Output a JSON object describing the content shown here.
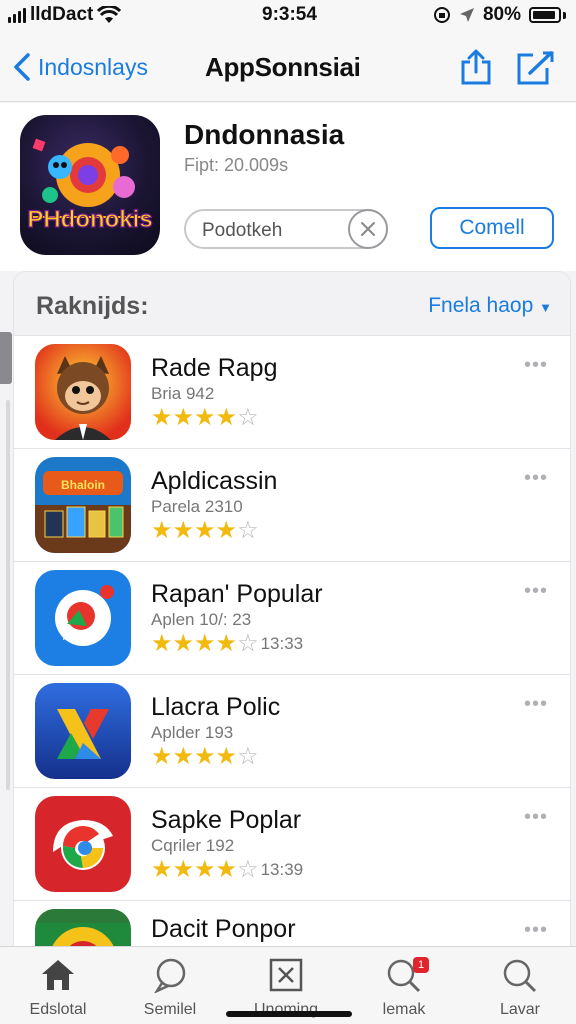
{
  "status_bar": {
    "carrier": "lldDact",
    "time": "9:3:54",
    "battery": "80%"
  },
  "nav": {
    "back_label": "Indosnlays",
    "title": "AppSonnsiai"
  },
  "app": {
    "name": "Dndonnasia",
    "subtitle": "Fipt: 20.009s",
    "icon_text": "PHdonokis",
    "search_value": "Podotkeh",
    "get_label": "Comell"
  },
  "rankings": {
    "title": "Raknijds:",
    "filter_label": "Fnela haop",
    "items": [
      {
        "name": "Rade Rapg",
        "sub": "Bria 942",
        "stars": 4,
        "count": ""
      },
      {
        "name": "Apldicassin",
        "sub": "Parela 2310",
        "stars": 4,
        "count": ""
      },
      {
        "name": "Rapan' Popular",
        "sub": "Aplen 10/: 23",
        "stars": 4,
        "count": "13:33"
      },
      {
        "name": "Llacra Polic",
        "sub": "Aplder 193",
        "stars": 4,
        "count": ""
      },
      {
        "name": "Sapke Poplar",
        "sub": "Cqriler 192",
        "stars": 4,
        "count": "13:39"
      },
      {
        "name": "Dacit Ponpor",
        "sub": "",
        "stars": 0,
        "count": ""
      }
    ]
  },
  "tabs": [
    {
      "label": "Edslotal",
      "icon": "house-icon"
    },
    {
      "label": "Semilel",
      "icon": "speech-bubble-icon"
    },
    {
      "label": "Unoming",
      "icon": "close-box-icon"
    },
    {
      "label": "lemak",
      "icon": "search-badge-icon",
      "badge": "1"
    },
    {
      "label": "Lavar",
      "icon": "search-icon"
    }
  ],
  "colors": {
    "accent": "#1a7ce0",
    "star": "#f2b90f",
    "badge": "#e0242c"
  }
}
